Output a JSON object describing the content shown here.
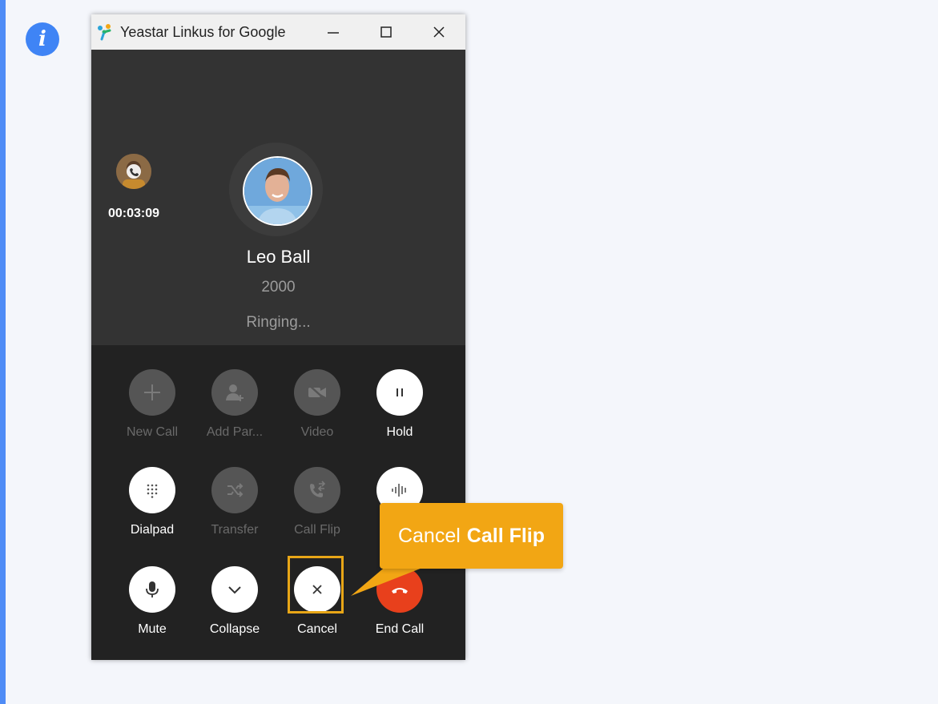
{
  "window": {
    "title": "Yeastar Linkus for Google",
    "controls": [
      "minimize",
      "maximize",
      "close"
    ]
  },
  "held_call": {
    "duration": "00:03:09"
  },
  "contact": {
    "name": "Leo Ball",
    "number": "2000",
    "status": "Ringing..."
  },
  "controls": [
    {
      "label": "New Call",
      "icon": "plus-icon",
      "enabled": false
    },
    {
      "label": "Add Par...",
      "icon": "add-person-icon",
      "enabled": false
    },
    {
      "label": "Video",
      "icon": "video-off-icon",
      "enabled": false
    },
    {
      "label": "Hold",
      "icon": "pause-icon",
      "enabled": true
    },
    {
      "label": "Dialpad",
      "icon": "dialpad-icon",
      "enabled": true
    },
    {
      "label": "Transfer",
      "icon": "transfer-icon",
      "enabled": false
    },
    {
      "label": "Call Flip",
      "icon": "call-flip-icon",
      "enabled": false
    },
    {
      "label": "",
      "icon": "audio-wave-icon",
      "enabled": true
    },
    {
      "label": "Mute",
      "icon": "microphone-icon",
      "enabled": true
    },
    {
      "label": "Collapse",
      "icon": "chevron-down-icon",
      "enabled": true
    },
    {
      "label": "Cancel",
      "icon": "close-icon",
      "enabled": true
    },
    {
      "label": "End Call",
      "icon": "hangup-icon",
      "enabled": true
    }
  ],
  "callout": {
    "prefix": "Cancel",
    "bold": "Call Flip"
  },
  "colors": {
    "accent_blue": "#3f84f5",
    "callout": "#f2a614",
    "end_call": "#e8401c",
    "window_bg": "#222222"
  }
}
